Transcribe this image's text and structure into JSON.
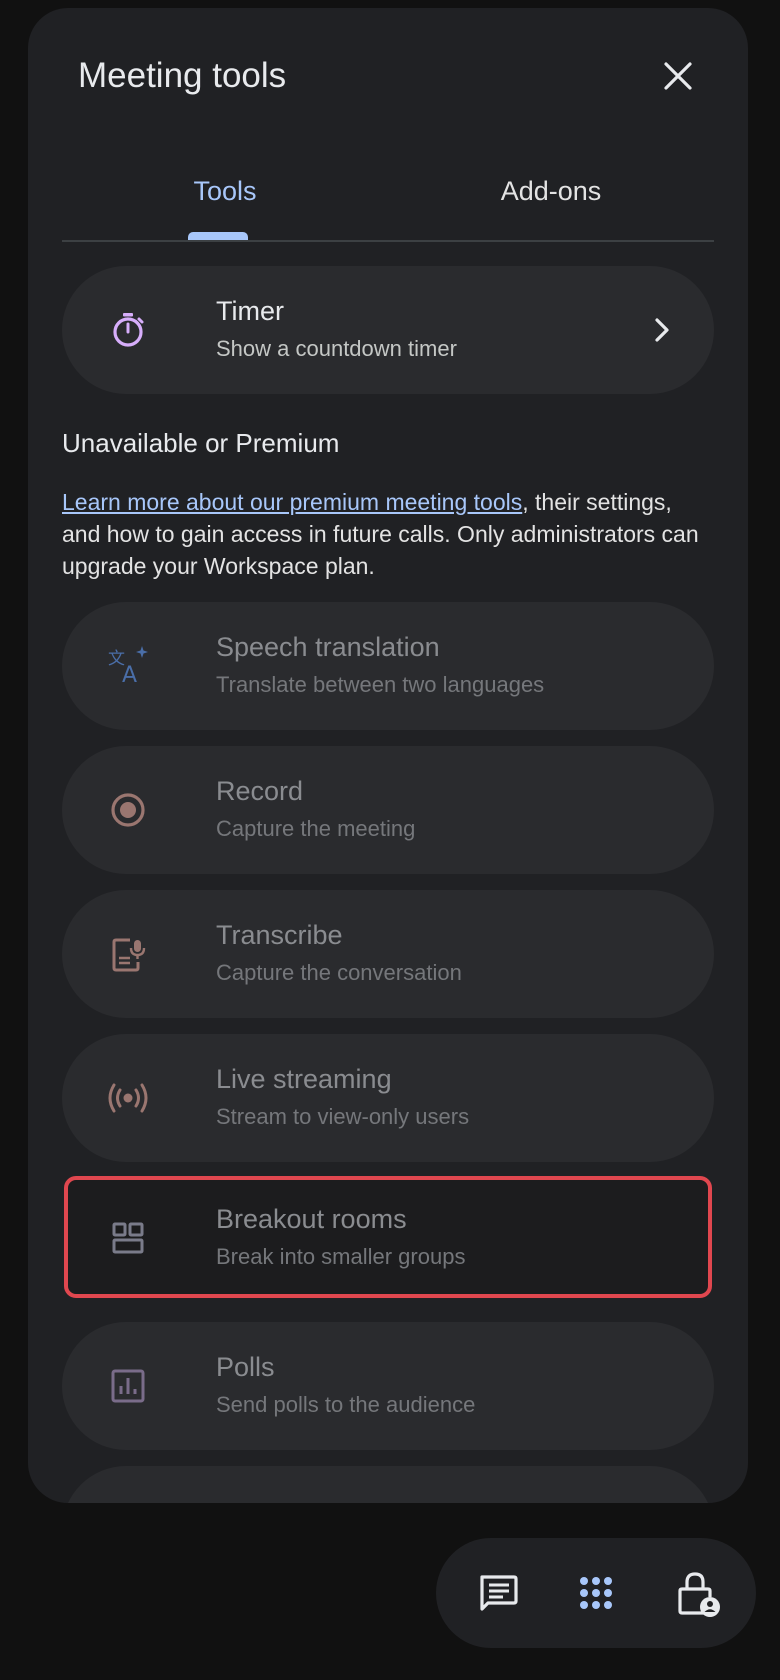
{
  "panel": {
    "title": "Meeting tools",
    "close_icon": "close-icon"
  },
  "tabs": [
    {
      "label": "Tools",
      "selected": true
    },
    {
      "label": "Add-ons",
      "selected": false
    }
  ],
  "timer": {
    "title": "Timer",
    "subtitle": "Show a countdown timer",
    "icon": "timer-icon"
  },
  "unavailable": {
    "heading": "Unavailable or Premium",
    "link_text": "Learn more about our premium meeting tools",
    "desc_rest": ", their settings, and how to gain access in future calls. Only administrators can upgrade your Workspace plan."
  },
  "items": [
    {
      "title": "Speech translation",
      "subtitle": "Translate between two languages",
      "icon": "translate-icon"
    },
    {
      "title": "Record",
      "subtitle": "Capture the meeting",
      "icon": "record-icon"
    },
    {
      "title": "Transcribe",
      "subtitle": "Capture the conversation",
      "icon": "transcribe-icon"
    },
    {
      "title": "Live streaming",
      "subtitle": "Stream to view-only users",
      "icon": "live-streaming-icon"
    },
    {
      "title": "Breakout rooms",
      "subtitle": "Break into smaller groups",
      "icon": "breakout-rooms-icon"
    },
    {
      "title": "Polls",
      "subtitle": "Send polls to the audience",
      "icon": "polls-icon"
    }
  ],
  "bottom_bar": [
    "chat-icon",
    "apps-grid-icon",
    "host-controls-lock-icon"
  ],
  "colors": {
    "accent": "#a8c7fa",
    "highlight_border": "#e0474f",
    "panel_bg": "#202124",
    "row_bg": "#2a2b2e"
  }
}
